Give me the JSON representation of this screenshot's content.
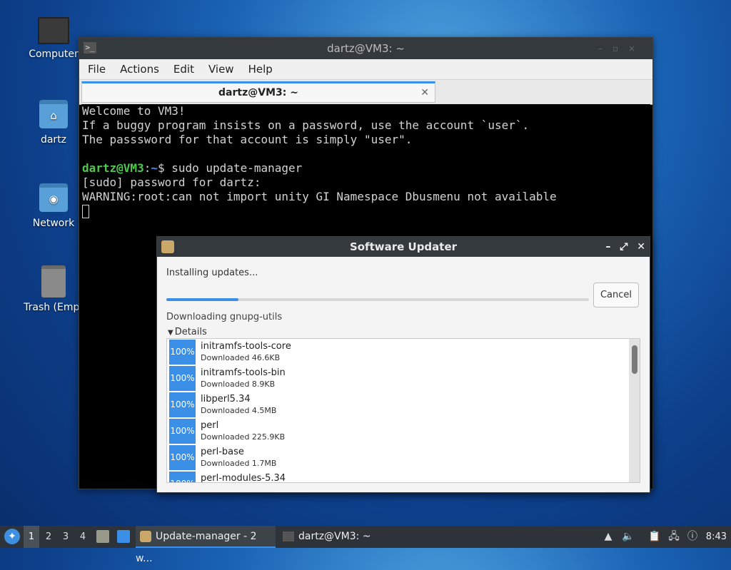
{
  "desktop": {
    "icons": [
      {
        "label": "Computer",
        "icon": "monitor-icon"
      },
      {
        "label": "dartz",
        "icon": "home-folder-icon"
      },
      {
        "label": "Network",
        "icon": "network-folder-icon"
      },
      {
        "label": "Trash (Empt",
        "icon": "trash-icon"
      }
    ]
  },
  "terminal": {
    "window_title": "dartz@VM3: ~",
    "menu": [
      "File",
      "Actions",
      "Edit",
      "View",
      "Help"
    ],
    "tab_title": "dartz@VM3: ~",
    "lines": {
      "l1": "Welcome to VM3!",
      "l2": "If a buggy program insists on a password, use the account `user`.",
      "l3": "The passsword for that account is simply \"user\".",
      "prompt_user": "dartz@VM3",
      "prompt_sep": ":",
      "prompt_path": "~",
      "prompt_cmd": "$ sudo update-manager",
      "l5": "[sudo] password for dartz:",
      "l6": "WARNING:root:can not import unity GI Namespace Dbusmenu not available"
    }
  },
  "updater": {
    "title": "Software Updater",
    "status": "Installing updates...",
    "progress_fraction": 0.17,
    "cancel_label": "Cancel",
    "downloading": "Downloading gnupg-utils",
    "details_label": "Details",
    "packages": [
      {
        "pct": "100%",
        "name": "initramfs-tools-core",
        "status": "Downloaded 46.6KB"
      },
      {
        "pct": "100%",
        "name": "initramfs-tools-bin",
        "status": "Downloaded 8.9KB"
      },
      {
        "pct": "100%",
        "name": "libperl5.34",
        "status": "Downloaded 4.5MB"
      },
      {
        "pct": "100%",
        "name": "perl",
        "status": "Downloaded 225.9KB"
      },
      {
        "pct": "100%",
        "name": "perl-base",
        "status": "Downloaded 1.7MB"
      },
      {
        "pct": "100%",
        "name": "perl-modules-5.34",
        "status": ""
      }
    ]
  },
  "taskbar": {
    "workspaces": [
      "1",
      "2",
      "3",
      "4"
    ],
    "active_workspace": "1",
    "tasks": [
      {
        "label": "Update-manager - 2 w...",
        "icon": "updater-app-icon"
      },
      {
        "label": "dartz@VM3: ~",
        "icon": "terminal-app-icon"
      }
    ],
    "clock": "8:43"
  }
}
